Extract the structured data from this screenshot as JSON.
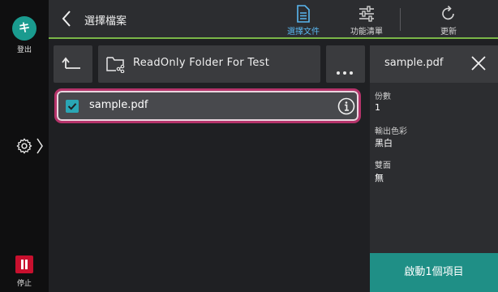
{
  "rail": {
    "logout_glyph": "キ",
    "logout_label": "登出",
    "stop_label": "停止",
    "colors": {
      "logout": "#1a9b8f",
      "stop": "#c8102e"
    }
  },
  "header": {
    "title": "選擇檔案",
    "buttons": [
      {
        "label": "選擇文件",
        "icon": "document-icon",
        "active": true
      },
      {
        "label": "功能清單",
        "icon": "sliders-icon",
        "active": false
      },
      {
        "label": "更新",
        "icon": "refresh-icon",
        "active": false
      }
    ],
    "accent": "#7ab648"
  },
  "toolbar": {
    "up_icon": "up-level-icon",
    "folder_name": "ReadOnly Folder For Test",
    "more_icon": "more-dots-icon"
  },
  "files": [
    {
      "name": "sample.pdf",
      "checked": true,
      "selected": true
    }
  ],
  "panel": {
    "file_name": "sample.pdf",
    "properties": [
      {
        "label": "份數",
        "value": "1"
      },
      {
        "label": "輸出色彩",
        "value": "黑白"
      },
      {
        "label": "雙面",
        "value": "無"
      }
    ],
    "start_label": "啟動1個項目",
    "start_color": "#1f8f86"
  }
}
